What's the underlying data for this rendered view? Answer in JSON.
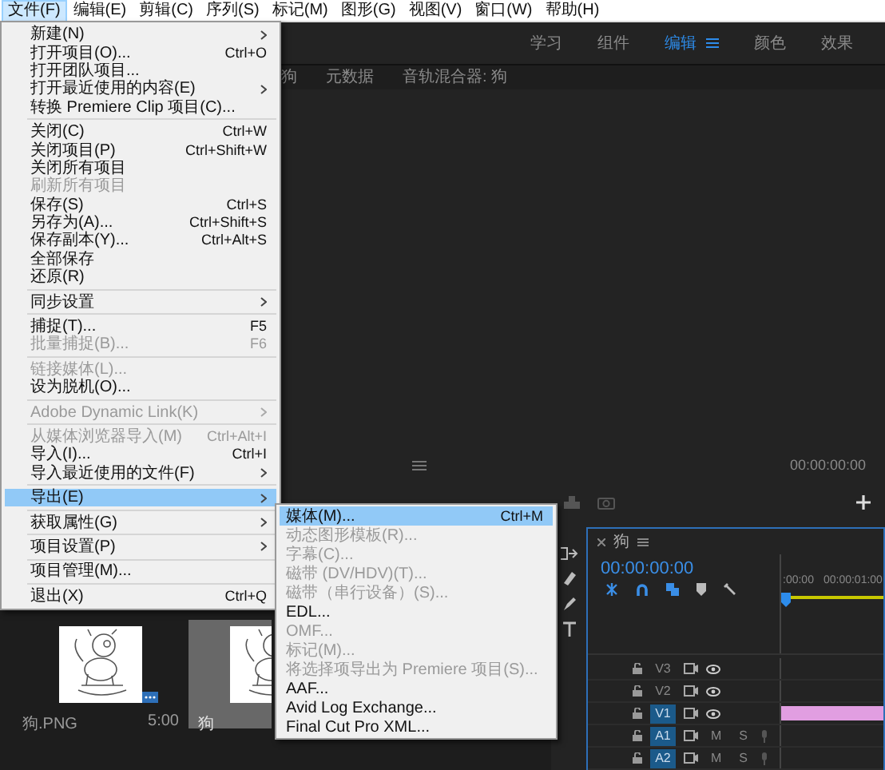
{
  "menubar": [
    {
      "label": "文件(F)",
      "selected": true
    },
    {
      "label": "编辑(E)",
      "selected": false
    },
    {
      "label": "剪辑(C)",
      "selected": false
    },
    {
      "label": "序列(S)",
      "selected": false
    },
    {
      "label": "标记(M)",
      "selected": false
    },
    {
      "label": "图形(G)",
      "selected": false
    },
    {
      "label": "视图(V)",
      "selected": false
    },
    {
      "label": "窗口(W)",
      "selected": false
    },
    {
      "label": "帮助(H)",
      "selected": false
    }
  ],
  "workspaces": [
    {
      "label": "学习",
      "selected": false
    },
    {
      "label": "组件",
      "selected": false
    },
    {
      "label": "编辑",
      "selected": true
    },
    {
      "label": "颜色",
      "selected": false
    },
    {
      "label": "效果",
      "selected": false
    }
  ],
  "source_panel": {
    "tabs": [
      "狗",
      "元数据",
      "音轨混合器: 狗"
    ],
    "timecode": "00:00:00:00"
  },
  "file_menu": [
    {
      "kind": "item",
      "label": "新建(N)",
      "submenu": true,
      "disabled": false,
      "selected": false
    },
    {
      "kind": "item",
      "label": "打开项目(O)...",
      "shortcut": "Ctrl+O",
      "submenu": false,
      "disabled": false,
      "selected": false
    },
    {
      "kind": "item",
      "label": "打开团队项目...",
      "submenu": false,
      "disabled": false,
      "selected": false
    },
    {
      "kind": "item",
      "label": "打开最近使用的内容(E)",
      "submenu": true,
      "disabled": false,
      "selected": false
    },
    {
      "kind": "item",
      "label": "转换 Premiere Clip 项目(C)...",
      "submenu": false,
      "disabled": false,
      "selected": false
    },
    {
      "kind": "separator"
    },
    {
      "kind": "item",
      "label": "关闭(C)",
      "shortcut": "Ctrl+W",
      "submenu": false,
      "disabled": false,
      "selected": false
    },
    {
      "kind": "item",
      "label": "关闭项目(P)",
      "shortcut": "Ctrl+Shift+W",
      "submenu": false,
      "disabled": false,
      "selected": false
    },
    {
      "kind": "item",
      "label": "关闭所有项目",
      "submenu": false,
      "disabled": false,
      "selected": false
    },
    {
      "kind": "item",
      "label": "刷新所有项目",
      "submenu": false,
      "disabled": true,
      "selected": false
    },
    {
      "kind": "item",
      "label": "保存(S)",
      "shortcut": "Ctrl+S",
      "submenu": false,
      "disabled": false,
      "selected": false
    },
    {
      "kind": "item",
      "label": "另存为(A)...",
      "shortcut": "Ctrl+Shift+S",
      "submenu": false,
      "disabled": false,
      "selected": false
    },
    {
      "kind": "item",
      "label": "保存副本(Y)...",
      "shortcut": "Ctrl+Alt+S",
      "submenu": false,
      "disabled": false,
      "selected": false
    },
    {
      "kind": "item",
      "label": "全部保存",
      "submenu": false,
      "disabled": false,
      "selected": false
    },
    {
      "kind": "item",
      "label": "还原(R)",
      "submenu": false,
      "disabled": false,
      "selected": false
    },
    {
      "kind": "separator"
    },
    {
      "kind": "item",
      "label": "同步设置",
      "submenu": true,
      "disabled": false,
      "selected": false
    },
    {
      "kind": "separator"
    },
    {
      "kind": "item",
      "label": "捕捉(T)...",
      "shortcut": "F5",
      "submenu": false,
      "disabled": false,
      "selected": false
    },
    {
      "kind": "item",
      "label": "批量捕捉(B)...",
      "shortcut": "F6",
      "submenu": false,
      "disabled": true,
      "selected": false
    },
    {
      "kind": "separator"
    },
    {
      "kind": "item",
      "label": "链接媒体(L)...",
      "submenu": false,
      "disabled": true,
      "selected": false
    },
    {
      "kind": "item",
      "label": "设为脱机(O)...",
      "submenu": false,
      "disabled": false,
      "selected": false
    },
    {
      "kind": "separator"
    },
    {
      "kind": "item",
      "label": "Adobe Dynamic Link(K)",
      "submenu": true,
      "disabled": true,
      "selected": false
    },
    {
      "kind": "separator"
    },
    {
      "kind": "item",
      "label": "从媒体浏览器导入(M)",
      "shortcut": "Ctrl+Alt+I",
      "submenu": false,
      "disabled": true,
      "selected": false
    },
    {
      "kind": "item",
      "label": "导入(I)...",
      "shortcut": "Ctrl+I",
      "submenu": false,
      "disabled": false,
      "selected": false
    },
    {
      "kind": "item",
      "label": "导入最近使用的文件(F)",
      "submenu": true,
      "disabled": false,
      "selected": false
    },
    {
      "kind": "separator"
    },
    {
      "kind": "item",
      "label": "导出(E)",
      "submenu": true,
      "disabled": false,
      "selected": true
    },
    {
      "kind": "separator"
    },
    {
      "kind": "item",
      "label": "获取属性(G)",
      "submenu": true,
      "disabled": false,
      "selected": false
    },
    {
      "kind": "separator"
    },
    {
      "kind": "item",
      "label": "项目设置(P)",
      "submenu": true,
      "disabled": false,
      "selected": false
    },
    {
      "kind": "separator"
    },
    {
      "kind": "item",
      "label": "项目管理(M)...",
      "submenu": false,
      "disabled": false,
      "selected": false
    },
    {
      "kind": "separator"
    },
    {
      "kind": "item",
      "label": "退出(X)",
      "shortcut": "Ctrl+Q",
      "submenu": false,
      "disabled": false,
      "selected": false
    }
  ],
  "export_submenu": [
    {
      "label": "媒体(M)...",
      "shortcut": "Ctrl+M",
      "disabled": false,
      "selected": true
    },
    {
      "label": "动态图形模板(R)...",
      "disabled": true,
      "selected": false
    },
    {
      "label": "字幕(C)...",
      "disabled": true,
      "selected": false
    },
    {
      "label": "磁带 (DV/HDV)(T)...",
      "disabled": true,
      "selected": false
    },
    {
      "label": "磁带（串行设备）(S)...",
      "disabled": true,
      "selected": false
    },
    {
      "label": "EDL...",
      "disabled": false,
      "selected": false
    },
    {
      "label": "OMF...",
      "disabled": true,
      "selected": false
    },
    {
      "label": "标记(M)...",
      "disabled": true,
      "selected": false
    },
    {
      "label": "将选择项导出为 Premiere 项目(S)...",
      "disabled": true,
      "selected": false
    },
    {
      "label": "AAF...",
      "disabled": false,
      "selected": false
    },
    {
      "label": "Avid Log Exchange...",
      "disabled": false,
      "selected": false
    },
    {
      "label": "Final Cut Pro XML...",
      "disabled": false,
      "selected": false
    }
  ],
  "project_items": [
    {
      "name": "狗.PNG",
      "duration": "5:00",
      "selected": false
    },
    {
      "name": "狗",
      "selected": true
    }
  ],
  "timeline": {
    "title": "狗",
    "timecode": "00:00:00:00",
    "ruler": [
      ":00:00",
      "00:00:01:00"
    ],
    "tracks": [
      {
        "label": "V3",
        "kind": "video",
        "targeted": false
      },
      {
        "label": "V2",
        "kind": "video",
        "targeted": false
      },
      {
        "label": "V1",
        "kind": "video",
        "targeted": true,
        "clip": true
      },
      {
        "label": "A1",
        "kind": "audio",
        "targeted": true,
        "mute": "M",
        "solo": "S"
      },
      {
        "label": "A2",
        "kind": "audio",
        "targeted": true,
        "mute": "M",
        "solo": "S"
      }
    ]
  }
}
